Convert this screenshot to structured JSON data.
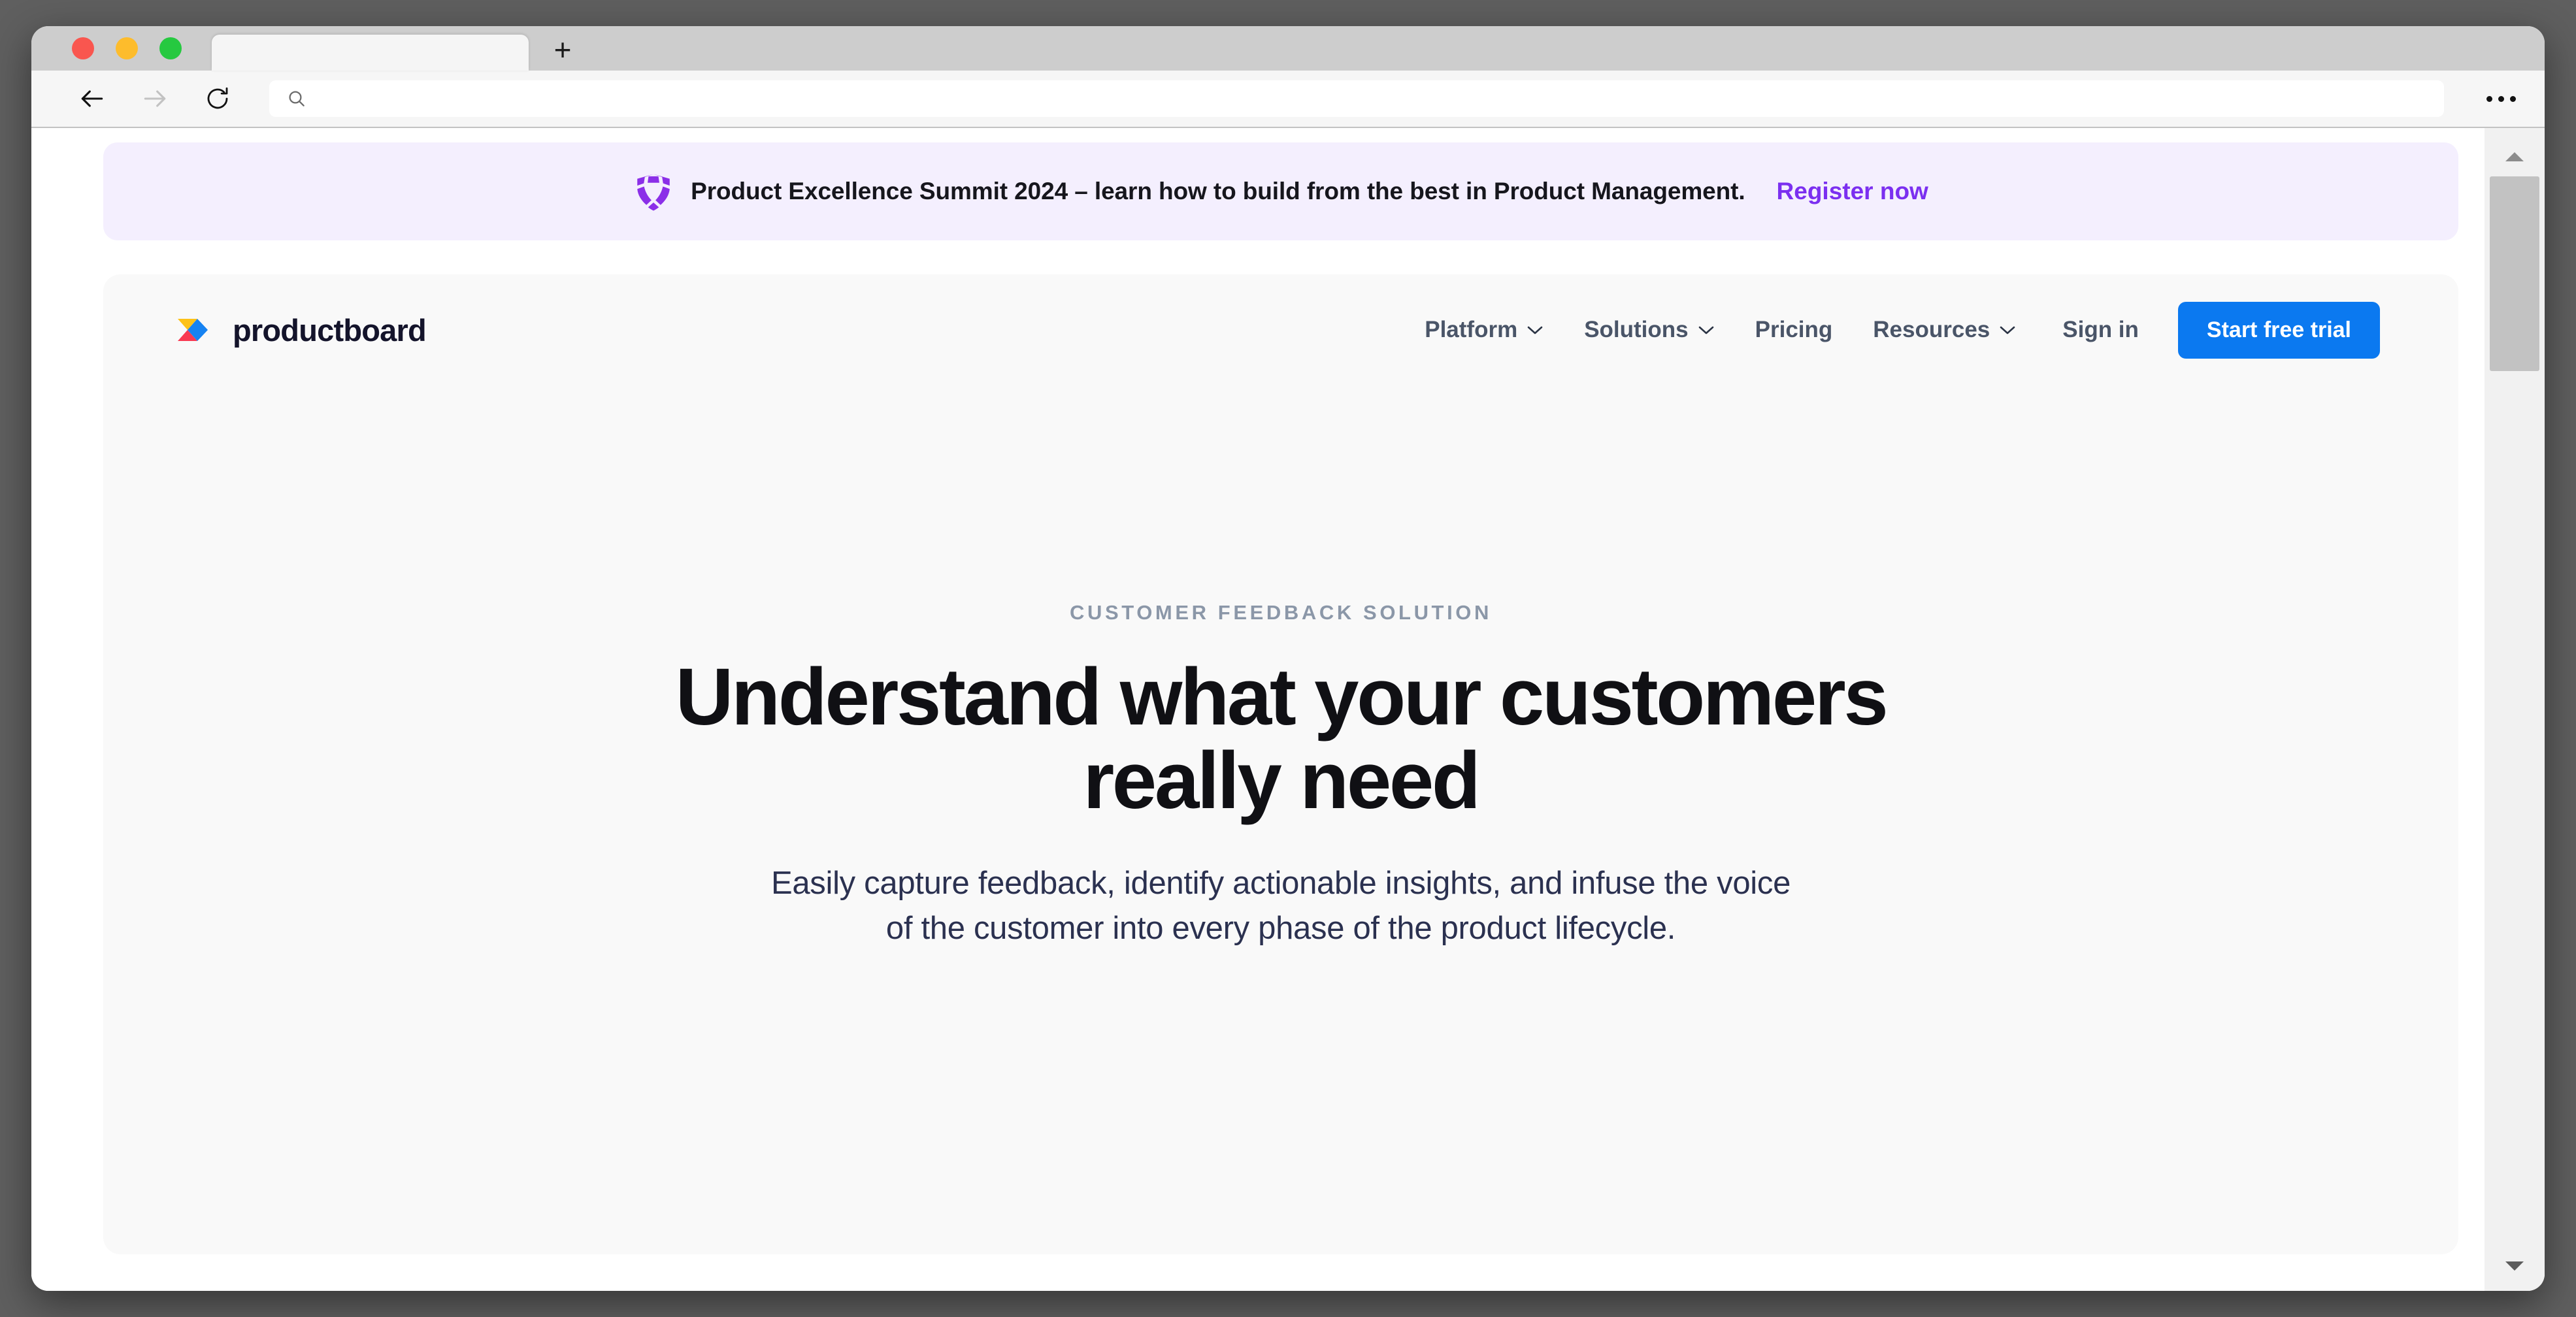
{
  "browser": {
    "tab_title": "",
    "new_tab_label": "+",
    "address_value": "",
    "address_placeholder": "",
    "back_label": "Back",
    "forward_label": "Forward",
    "reload_label": "Reload",
    "menu_label": "More options",
    "traffic_lights": {
      "close_color": "#f9564f",
      "minimize_color": "#fdbc2c",
      "maximize_color": "#26c940"
    }
  },
  "announcement": {
    "icon": "shield-icon",
    "text": "Product Excellence Summit 2024 – learn how to build from the best in Product Management.",
    "link_label": "Register now",
    "background": "#f4effe",
    "link_color": "#7b2ff0"
  },
  "site": {
    "brand_name": "productboard",
    "nav": [
      {
        "label": "Platform",
        "has_dropdown": true
      },
      {
        "label": "Solutions",
        "has_dropdown": true
      },
      {
        "label": "Pricing",
        "has_dropdown": false
      },
      {
        "label": "Resources",
        "has_dropdown": true
      }
    ],
    "sign_in_label": "Sign in",
    "cta_label": "Start free trial",
    "cta_color": "#0b79f0"
  },
  "hero": {
    "eyebrow": "CUSTOMER FEEDBACK SOLUTION",
    "title_line1": "Understand what your customers",
    "title_line2": "really need",
    "subtitle_line1": "Easily capture feedback, identify actionable insights, and infuse the voice",
    "subtitle_line2": "of the customer into every phase of the product lifecycle."
  },
  "scrollbar": {
    "up_arrow": "scroll-up-icon",
    "down_arrow": "scroll-down-icon",
    "position": "top"
  }
}
